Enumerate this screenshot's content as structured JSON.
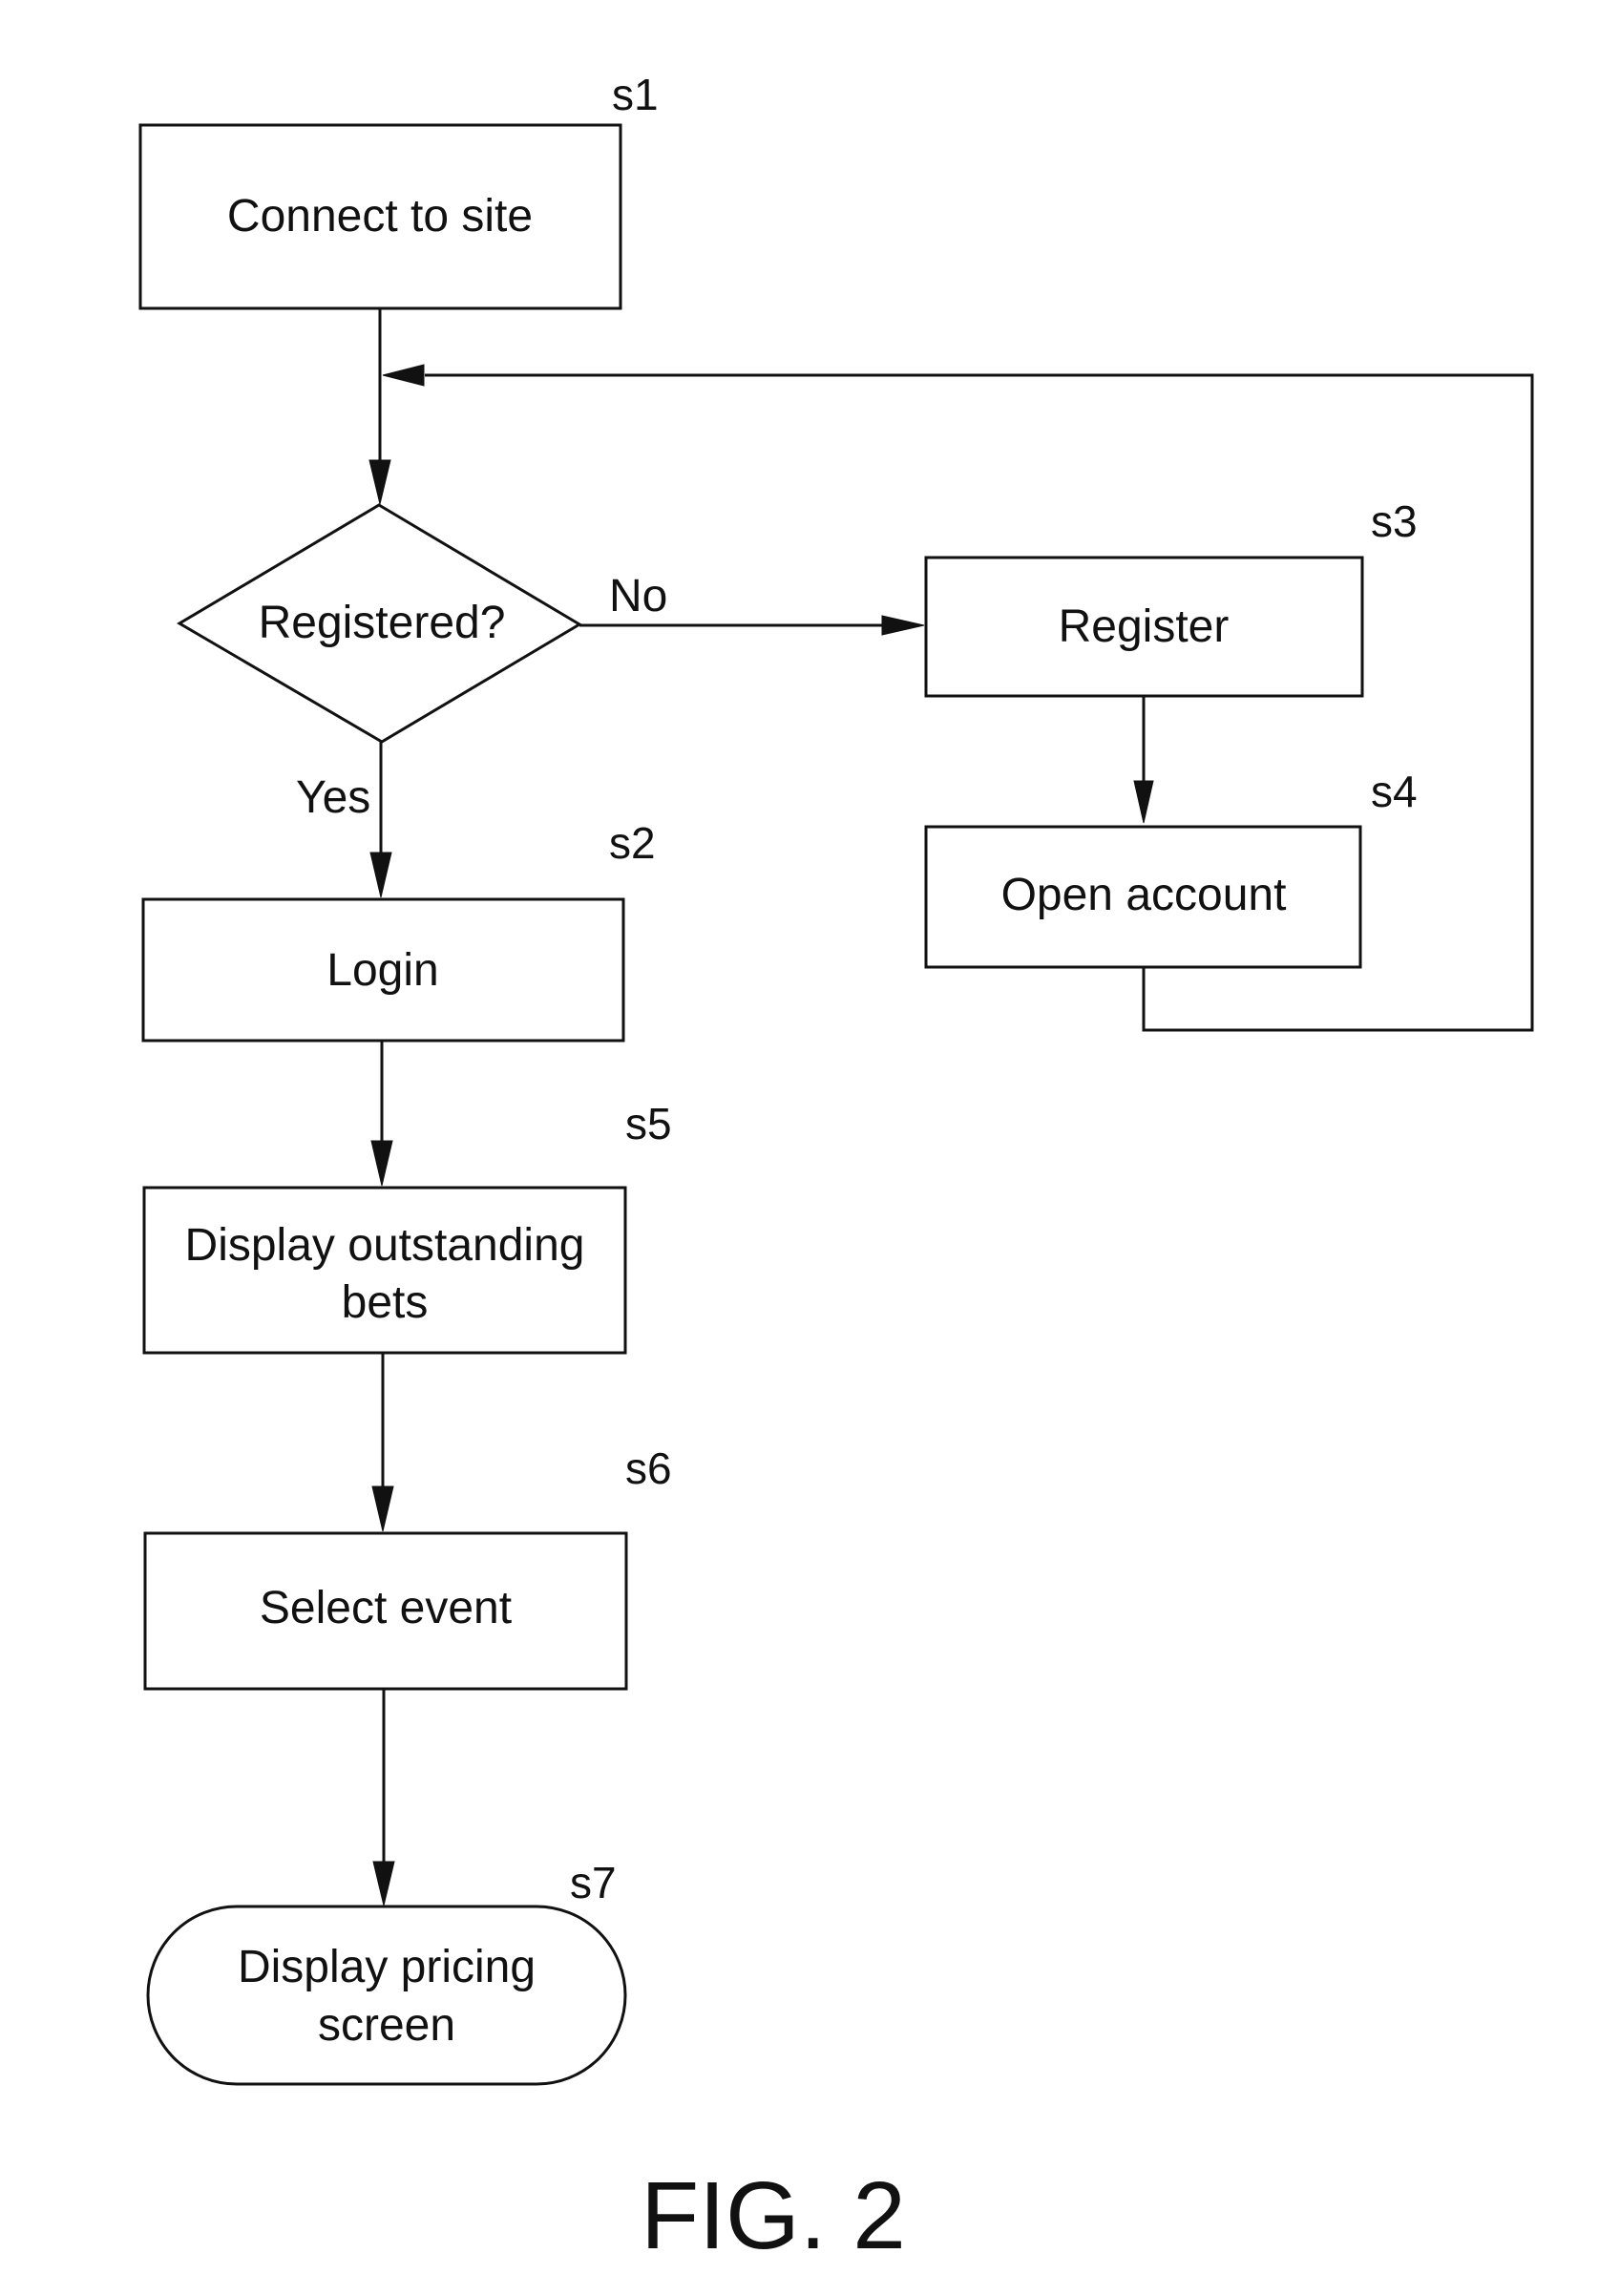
{
  "figure": {
    "caption": "FIG. 2",
    "ink_color": "#111111",
    "background": "#ffffff"
  },
  "nodes": {
    "s1": {
      "id": "s1",
      "type": "process",
      "lines": [
        "Connect to site"
      ]
    },
    "decision": {
      "type": "decision",
      "lines": [
        "Registered?"
      ]
    },
    "s3": {
      "id": "s3",
      "type": "process",
      "lines": [
        "Register"
      ]
    },
    "s4": {
      "id": "s4",
      "type": "process",
      "lines": [
        "Open account"
      ]
    },
    "s2": {
      "id": "s2",
      "type": "process",
      "lines": [
        "Login"
      ]
    },
    "s5": {
      "id": "s5",
      "type": "process",
      "lines": [
        "Display outstanding",
        "bets"
      ]
    },
    "s6": {
      "id": "s6",
      "type": "process",
      "lines": [
        "Select event"
      ]
    },
    "s7": {
      "id": "s7",
      "type": "terminal",
      "lines": [
        "Display pricing",
        "screen"
      ]
    }
  },
  "edges": [
    {
      "from": "s1",
      "to": "decision",
      "label": ""
    },
    {
      "from": "decision",
      "to": "s3",
      "label": "No"
    },
    {
      "from": "decision",
      "to": "s2",
      "label": "Yes"
    },
    {
      "from": "s3",
      "to": "s4",
      "label": ""
    },
    {
      "from": "s4",
      "to": "decision",
      "label": "",
      "note": "loops back above decision"
    },
    {
      "from": "s2",
      "to": "s5",
      "label": ""
    },
    {
      "from": "s5",
      "to": "s6",
      "label": ""
    },
    {
      "from": "s6",
      "to": "s7",
      "label": ""
    }
  ],
  "edge_labels": {
    "no": "No",
    "yes": "Yes"
  }
}
